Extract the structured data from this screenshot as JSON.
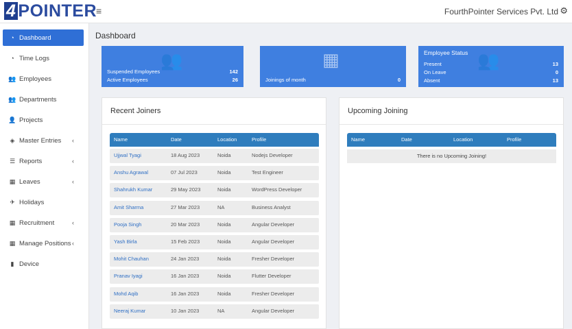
{
  "header": {
    "logo_num": "4",
    "logo_text": "POINTER",
    "hamburger_icon": "≡",
    "company": "FourthPointer Services Pvt. Ltd",
    "gear_icon": "⚙"
  },
  "sidebar": {
    "items": [
      {
        "label": "Dashboard",
        "icon": "◔",
        "chev": ""
      },
      {
        "label": "Time Logs",
        "icon": "◔",
        "chev": ""
      },
      {
        "label": "Employees",
        "icon": "👥",
        "chev": ""
      },
      {
        "label": "Departments",
        "icon": "👥",
        "chev": ""
      },
      {
        "label": "Projects",
        "icon": "👤",
        "chev": ""
      },
      {
        "label": "Master Entries",
        "icon": "◈",
        "chev": "‹"
      },
      {
        "label": "Reports",
        "icon": "☰",
        "chev": "‹"
      },
      {
        "label": "Leaves",
        "icon": "▦",
        "chev": "‹"
      },
      {
        "label": "Holidays",
        "icon": "✈",
        "chev": ""
      },
      {
        "label": "Recruitment",
        "icon": "▦",
        "chev": "‹"
      },
      {
        "label": "Manage Positions",
        "icon": "▦",
        "chev": "‹"
      },
      {
        "label": "Device",
        "icon": "▮",
        "chev": ""
      }
    ]
  },
  "main": {
    "title": "Dashboard",
    "cards": {
      "employees": {
        "icon": "👥",
        "suspended_label": "Suspended Employees",
        "suspended_value": "142",
        "active_label": "Active Employees",
        "active_value": "26"
      },
      "joinings": {
        "icon": "▦",
        "label": "Joinings of month",
        "value": "0"
      },
      "status": {
        "icon": "👥",
        "title": "Employee Status",
        "present_label": "Present",
        "present_value": "13",
        "leave_label": "On Leave",
        "leave_value": "0",
        "absent_label": "Absent",
        "absent_value": "13"
      }
    },
    "recent": {
      "title": "Recent Joiners",
      "columns": [
        "Name",
        "Date",
        "Location",
        "Profile"
      ],
      "rows": [
        {
          "name": "Ujjwal Tyagi",
          "date": "18 Aug 2023",
          "location": "Noida",
          "profile": "Nodejs Developer"
        },
        {
          "name": "Anshu Agrawal",
          "date": "07 Jul 2023",
          "location": "Noida",
          "profile": "Test Engineer"
        },
        {
          "name": "Shahrukh Kumar",
          "date": "29 May 2023",
          "location": "Noida",
          "profile": "WordPress Developer"
        },
        {
          "name": "Amit Sharma",
          "date": "27 Mar 2023",
          "location": "NA",
          "profile": "Business Analyst"
        },
        {
          "name": "Pooja Singh",
          "date": "20 Mar 2023",
          "location": "Noida",
          "profile": "Angular Developer"
        },
        {
          "name": "Yash Birla",
          "date": "15 Feb 2023",
          "location": "Noida",
          "profile": "Angular Developer"
        },
        {
          "name": "Mohit Chauhan",
          "date": "24 Jan 2023",
          "location": "Noida",
          "profile": "Fresher Developer"
        },
        {
          "name": "Pranav Iyagi",
          "date": "16 Jan 2023",
          "location": "Noida",
          "profile": "Flutter Developer"
        },
        {
          "name": "Mohd Aqib",
          "date": "16 Jan 2023",
          "location": "Noida",
          "profile": "Fresher Developer"
        },
        {
          "name": "Neeraj Kumar",
          "date": "10 Jan 2023",
          "location": "NA",
          "profile": "Angular Developer"
        }
      ]
    },
    "upcoming": {
      "title": "Upcoming Joining",
      "columns": [
        "Name",
        "Date",
        "Location",
        "Profile"
      ],
      "empty": "There is no Upcoming Joining!"
    }
  },
  "colors": {
    "accent": "#3f7fe0",
    "table_header": "#2f7dbd",
    "active_nav": "#2f6fd6"
  }
}
